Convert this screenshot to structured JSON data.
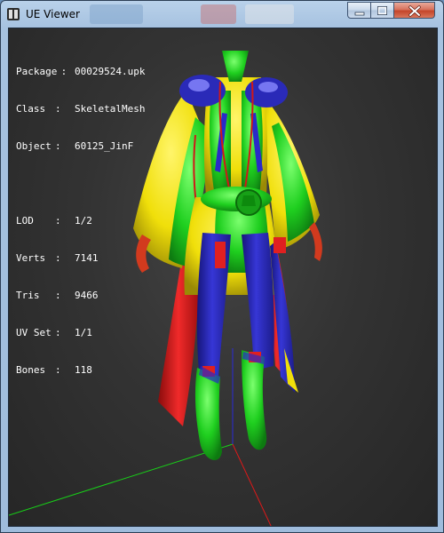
{
  "window": {
    "title": "UE Viewer",
    "controls": {
      "minimize": "minimize",
      "maximize": "maximize",
      "close": "close"
    }
  },
  "info": {
    "package_label": "Package",
    "package_value": "00029524.upk",
    "class_label": "Class",
    "class_value": "SkeletalMesh",
    "object_label": "Object",
    "object_value": "60125_JinF",
    "lod_label": "LOD",
    "lod_value": "1/2",
    "verts_label": "Verts",
    "verts_value": "7141",
    "tris_label": "Tris",
    "tris_value": "9466",
    "uvset_label": "UV Set",
    "uvset_value": "1/1",
    "bones_label": "Bones",
    "bones_value": "118"
  },
  "colors": {
    "viewport_bg": "#333333",
    "axis_x": "#e01818",
    "axis_y": "#18d018",
    "axis_z": "#2a2ad8",
    "mesh_yellow": "#f2e40a",
    "mesh_green": "#1ed020",
    "mesh_blue": "#2a2ac8",
    "mesh_red": "#e02020"
  }
}
